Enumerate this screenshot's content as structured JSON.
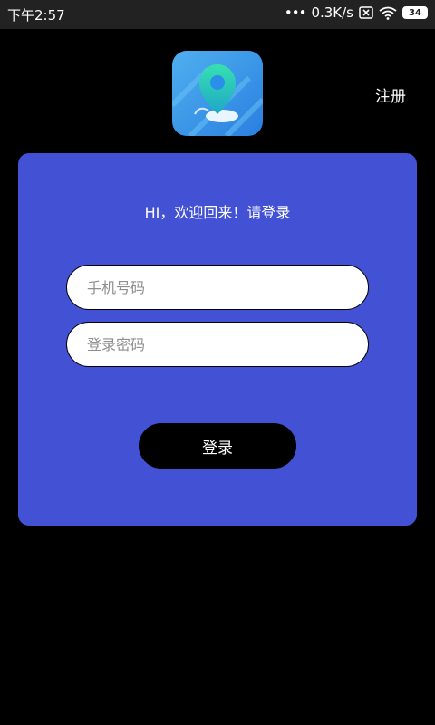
{
  "status_bar": {
    "time": "下午2:57",
    "dots": "•••",
    "net_speed": "0.3K/s",
    "battery": "34",
    "icons": [
      "sim-blocked-icon",
      "wifi-icon",
      "battery-icon"
    ]
  },
  "header": {
    "app_icon": "location-pin-icon",
    "register_label": "注册"
  },
  "login_card": {
    "welcome_text": "HI，欢迎回来！请登录",
    "phone_placeholder": "手机号码",
    "password_placeholder": "登录密码",
    "login_label": "登录"
  },
  "colors": {
    "background": "#000000",
    "status_bar": "#222222",
    "card": "#4351d4",
    "button": "#000000",
    "input": "#ffffff"
  }
}
